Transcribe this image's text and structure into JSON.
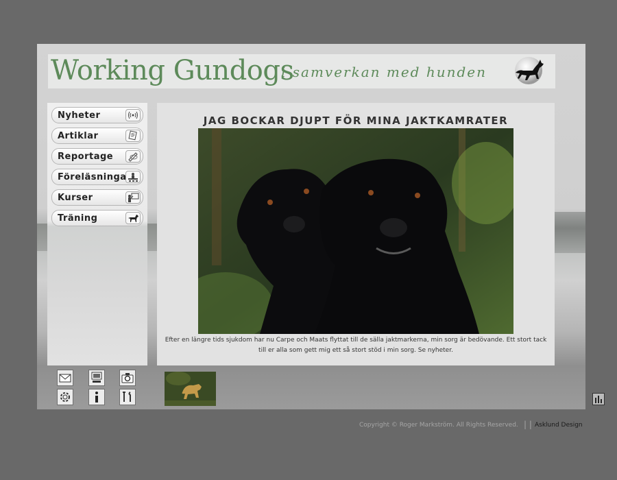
{
  "header": {
    "logo_text": "Working Gundogs",
    "tagline": "i samverkan med hunden",
    "logo_icon": "dog-silhouette-icon"
  },
  "nav": {
    "items": [
      {
        "label": "Nyheter",
        "icon": "broadcast-icon"
      },
      {
        "label": "Artiklar",
        "icon": "documents-icon"
      },
      {
        "label": "Reportage",
        "icon": "pen-icon"
      },
      {
        "label": "Föreläsningar",
        "icon": "presenter-icon"
      },
      {
        "label": "Kurser",
        "icon": "teacher-icon"
      },
      {
        "label": "Träning",
        "icon": "dog-icon"
      }
    ]
  },
  "article": {
    "title": "JAG BOCKAR DJUPT FÖR MINA JAKTKAMRATER",
    "caption": "Efter en längre tids sjukdom har nu Carpe och Maats flyttat till de sälla jaktmarkerna, min sorg är bedövande. Ett stort tack till er alla som gett mig ett så stort stöd i min sorg. Se nyheter."
  },
  "tools": {
    "icons": [
      "mail-icon",
      "computer-icon",
      "camera-icon",
      "gear-icon",
      "info-icon",
      "tools-icon"
    ]
  },
  "footer": {
    "copyright": "Copyright © Roger Markström. All Rights Reserved.",
    "separator": "| |",
    "design_link": "Asklund Design"
  },
  "colors": {
    "page_bg": "#696969",
    "logo_green": "#5d8a5a",
    "panel_bg": "#e2e2e2"
  }
}
